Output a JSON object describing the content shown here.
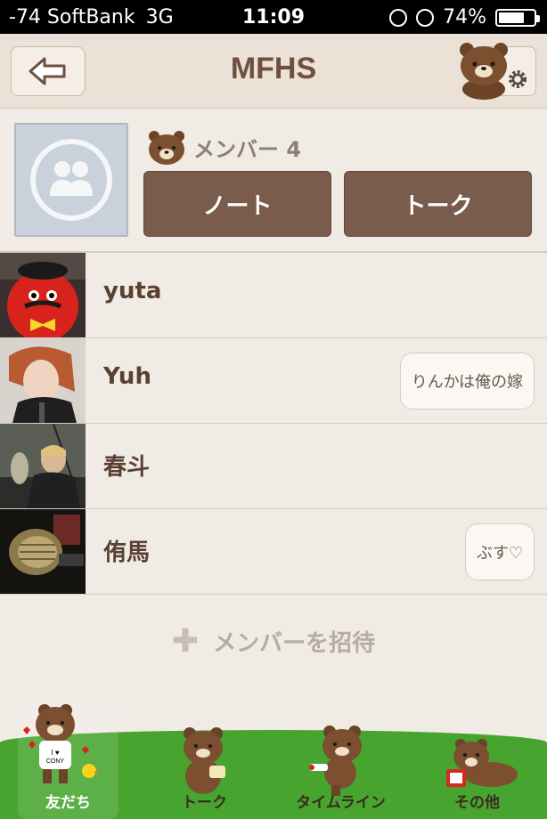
{
  "status_bar": {
    "carrier": "-74 SoftBank",
    "network": "3G",
    "time": "11:09",
    "battery": "74%",
    "battery_level": 0.74
  },
  "header": {
    "title": "MFHS",
    "back_icon": "back-arrow-icon",
    "settings_icon": "gear-icon"
  },
  "group": {
    "member_label": "メンバー 4",
    "note_button": "ノート",
    "talk_button": "トーク"
  },
  "members": [
    {
      "name": "yuta",
      "status": ""
    },
    {
      "name": "Yuh",
      "status": "りんかは俺の嫁"
    },
    {
      "name": "春斗",
      "status": ""
    },
    {
      "name": "侑馬",
      "status": "ぶす♡"
    }
  ],
  "invite": {
    "label": "メンバーを招待"
  },
  "tabs": [
    {
      "label": "友だち",
      "active": true
    },
    {
      "label": "トーク",
      "active": false
    },
    {
      "label": "タイムライン",
      "active": false
    },
    {
      "label": "その他",
      "active": false
    }
  ],
  "colors": {
    "accent": "#7a5c4d",
    "header_bg": "#ebe1d6",
    "grass": "#47a42e"
  }
}
